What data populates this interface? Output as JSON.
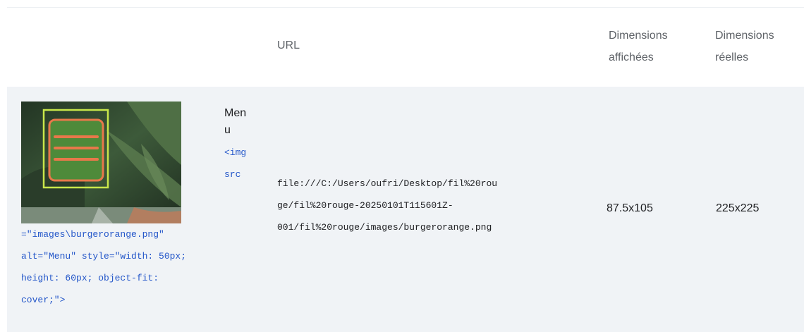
{
  "table": {
    "headers": {
      "url": "URL",
      "displayed": [
        "Dimensions",
        "affichées"
      ],
      "real": [
        "Dimensions",
        "réelles"
      ]
    },
    "row": {
      "alt_text": "Menu",
      "code_narrow": "<img src",
      "code_wide_lines": [
        "=\"images\\burgerorange.png\"",
        "alt=\"Menu\" style=\"width: 50px;",
        "height: 60px; object-fit:",
        "cover;\">"
      ],
      "url_lines": [
        "file:///C:/Users/oufri/Desktop/fil%20rou",
        "ge/fil%20rouge-20250101T115601Z-",
        "001/fil%20rouge/images/burgerorange.png"
      ],
      "displayed_dimensions": "87.5x105",
      "real_dimensions": "225x225"
    }
  },
  "colors": {
    "row_background": "#f0f3f6",
    "code_blue": "#2356c9",
    "highlight_frame": "#c8e64a",
    "burger_orange": "#e8784a"
  },
  "icons": {
    "thumbnail": "burger-menu-image"
  }
}
